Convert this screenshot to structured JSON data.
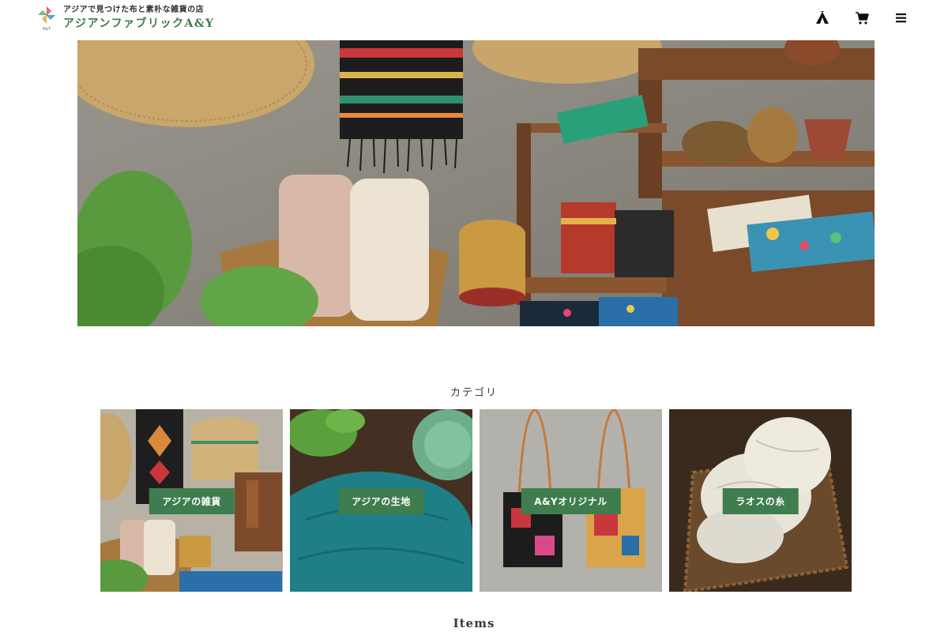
{
  "header": {
    "logo_tagline": "アジアで見つけた布と素朴な雑貨の店",
    "logo_name": "アジアンファブリックA&Y",
    "logo_mark_text": "A&Y",
    "icons": [
      "tent-icon",
      "cart-icon",
      "menu-icon"
    ]
  },
  "hero": {
    "alt_icon": "shop-display-photo"
  },
  "categories": {
    "title": "カテゴリ",
    "items": [
      {
        "label": "アジアの雑貨"
      },
      {
        "label": "アジアの生地"
      },
      {
        "label": "A&Yオリジナル"
      },
      {
        "label": "ラオスの糸"
      }
    ]
  },
  "items_section": {
    "title": "Items"
  },
  "colors": {
    "brand_green": "#3f7d4e",
    "logo_green": "#3d7a4a"
  }
}
